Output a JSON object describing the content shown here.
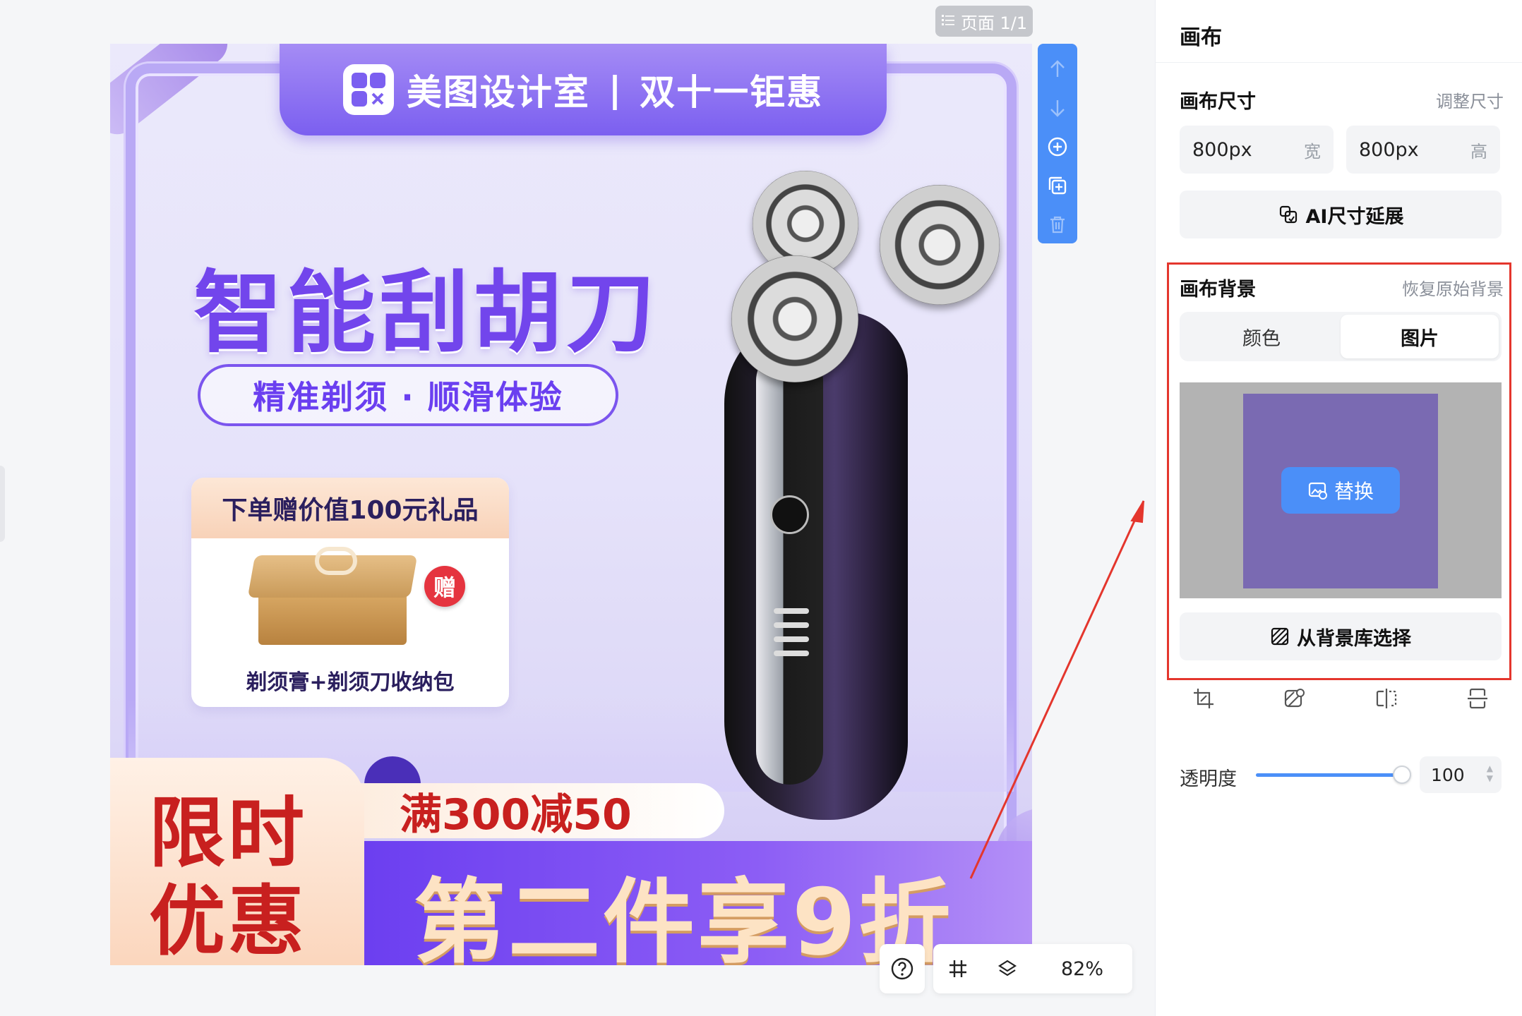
{
  "toolbar": {
    "page_indicator": "页面 1/1",
    "zoom": "82%"
  },
  "canvas": {
    "brand": "美图设计室",
    "separator": "|",
    "event": "双十一钜惠",
    "headline": "智能刮胡刀",
    "subline": "精准剃须 · 顺滑体验",
    "gift_title": "下单赠价值100元礼品",
    "gift_badge": "赠",
    "gift_caption": "剃须膏+剃须刀收纳包",
    "promo_label_line1": "限时",
    "promo_label_line2": "优惠",
    "promo_discount": "满300减50",
    "promo_offer": "第二件享9折"
  },
  "panel": {
    "title": "画布",
    "size_section": {
      "title": "画布尺寸",
      "link": "调整尺寸",
      "width_value": "800px",
      "width_unit": "宽",
      "height_value": "800px",
      "height_unit": "高",
      "ai_button": "AI尺寸延展"
    },
    "background_section": {
      "title": "画布背景",
      "link": "恢复原始背景",
      "tabs": [
        "颜色",
        "图片"
      ],
      "selected_tab": "图片",
      "replace_button": "替换",
      "library_button": "从背景库选择",
      "preview_color": "#7a6ab2"
    },
    "opacity": {
      "label": "透明度",
      "value": "100",
      "level_percent": 100
    }
  },
  "colors": {
    "accent": "#4b8ff8",
    "highlight_box": "#e4362d",
    "brand_purple": "#7245ec"
  }
}
